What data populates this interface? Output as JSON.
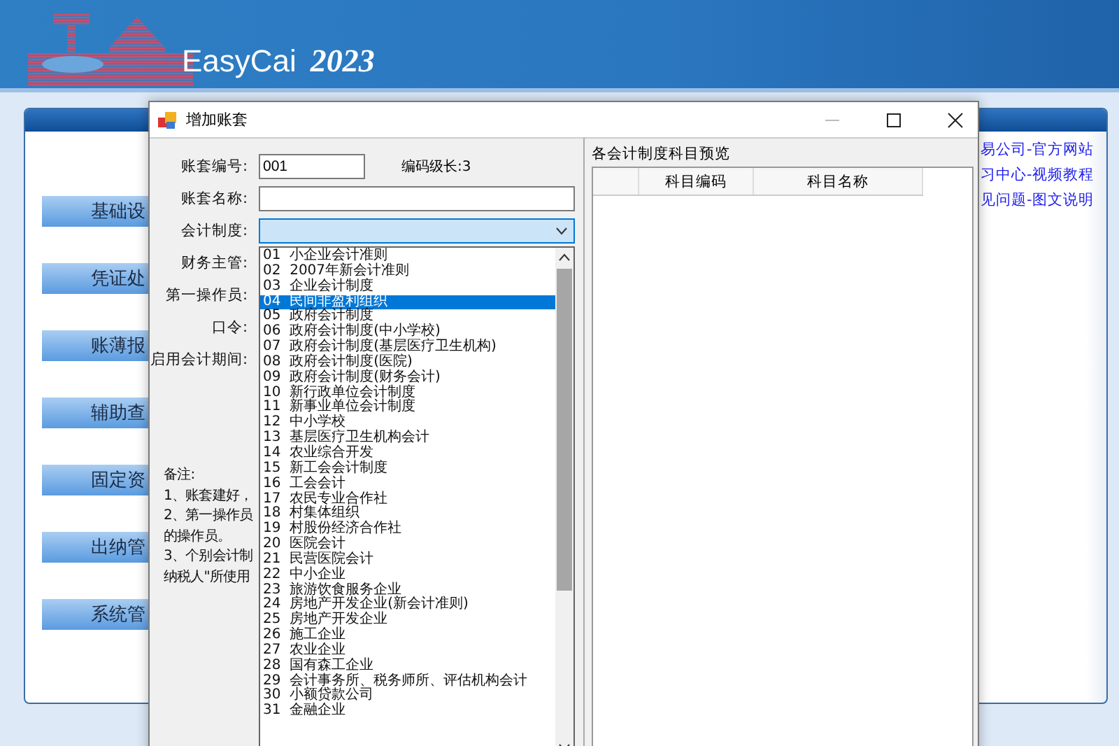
{
  "app": {
    "title": "EasyCai",
    "version": "2023"
  },
  "nav_buttons": [
    "基础设",
    "凭证处",
    "账薄报",
    "辅助查",
    "固定资",
    "出纳管",
    "系统管"
  ],
  "links": [
    "易公司-官方网站",
    "习中心-视频教程",
    "见问题-图文说明"
  ],
  "dialog": {
    "title": "增加账套",
    "fields": [
      {
        "label": "账套编号:",
        "kind": "short",
        "value": "001",
        "note": "编码级长:3"
      },
      {
        "label": "账套名称:",
        "kind": "text"
      },
      {
        "label": "会计制度:",
        "kind": "combo"
      },
      {
        "label": "财务主管:",
        "kind": "covered"
      },
      {
        "label": "第一操作员:",
        "kind": "covered"
      },
      {
        "label": "口令:",
        "kind": "covered"
      },
      {
        "label": "启用会计期间:",
        "kind": "covered"
      }
    ],
    "notes": [
      "备注:",
      "1、账套建好，",
      "2、第一操作员",
      "的操作员。",
      "3、个别会计制",
      "纳税人\"所使用"
    ],
    "preview": {
      "title": "各会计制度科目预览",
      "columns": [
        "科目编码",
        "科目名称"
      ]
    }
  },
  "dropdown": {
    "items": [
      {
        "label": "01  小企业会计准则",
        "selected": false
      },
      {
        "label": "02  2007年新会计准则",
        "selected": false
      },
      {
        "label": "03  企业会计制度",
        "selected": false
      },
      {
        "label": "04  民间非盈利组织",
        "selected": true
      },
      {
        "label": "05  政府会计制度",
        "selected": false
      },
      {
        "label": "06  政府会计制度(中小学校)",
        "selected": false
      },
      {
        "label": "07  政府会计制度(基层医疗卫生机构)",
        "selected": false
      },
      {
        "label": "08  政府会计制度(医院)",
        "selected": false
      },
      {
        "label": "09  政府会计制度(财务会计)",
        "selected": false
      },
      {
        "label": "10  新行政单位会计制度",
        "selected": false
      },
      {
        "label": "11  新事业单位会计制度",
        "selected": false
      },
      {
        "label": "12  中小学校",
        "selected": false
      },
      {
        "label": "13  基层医疗卫生机构会计",
        "selected": false
      },
      {
        "label": "14  农业综合开发",
        "selected": false
      },
      {
        "label": "15  新工会会计制度",
        "selected": false
      },
      {
        "label": "16  工会会计",
        "selected": false
      },
      {
        "label": "17  农民专业合作社",
        "selected": false
      },
      {
        "label": "18  村集体组织",
        "selected": false
      },
      {
        "label": "19  村股份经济合作社",
        "selected": false
      },
      {
        "label": "20  医院会计",
        "selected": false
      },
      {
        "label": "21  民营医院会计",
        "selected": false
      },
      {
        "label": "22  中小企业",
        "selected": false
      },
      {
        "label": "23  旅游饮食服务企业",
        "selected": false
      },
      {
        "label": "24  房地产开发企业(新会计准则)",
        "selected": false
      },
      {
        "label": "25  房地产开发企业",
        "selected": false
      },
      {
        "label": "26  施工企业",
        "selected": false
      },
      {
        "label": "27  农业企业",
        "selected": false
      },
      {
        "label": "28  国有森工企业",
        "selected": false
      },
      {
        "label": "29  会计事务所、税务师所、评估机构会计",
        "selected": false
      },
      {
        "label": "30  小额贷款公司",
        "selected": false
      },
      {
        "label": "31  金融企业",
        "selected": false
      }
    ]
  }
}
